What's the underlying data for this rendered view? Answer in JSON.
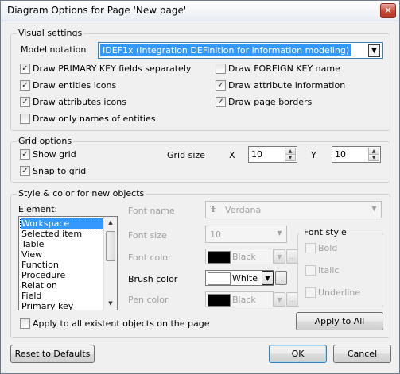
{
  "window": {
    "title": "Diagram Options for Page 'New page'",
    "close_glyph": "✕"
  },
  "visual_settings": {
    "title": "Visual settings",
    "model_notation_label": "Model notation",
    "model_notation_value": "IDEF1x (Integration DEFinition for information modeling)",
    "options": [
      {
        "label": "Draw PRIMARY KEY fields separately",
        "checked": true
      },
      {
        "label": "Draw entities icons",
        "checked": true
      },
      {
        "label": "Draw attributes icons",
        "checked": true
      },
      {
        "label": "Draw only names of entities",
        "checked": false
      },
      {
        "label": "Draw FOREIGN KEY name",
        "checked": false
      },
      {
        "label": "Draw attribute information",
        "checked": true
      },
      {
        "label": "Draw page borders",
        "checked": true
      }
    ]
  },
  "grid_options": {
    "title": "Grid options",
    "show_grid": {
      "label": "Show grid",
      "checked": true
    },
    "snap_to_grid": {
      "label": "Snap to grid",
      "checked": true
    },
    "grid_size_label": "Grid size",
    "x_label": "X",
    "x_value": "10",
    "y_label": "Y",
    "y_value": "10"
  },
  "style": {
    "title": "Style & color for new objects",
    "element_label": "Element:",
    "elements": [
      "Workspace",
      "Selected item",
      "Table",
      "View",
      "Function",
      "Procedure",
      "Relation",
      "Field",
      "Primary key"
    ],
    "selected_index": 0,
    "font_name_label": "Font name",
    "font_name_value": "Verdana",
    "font_size_label": "Font size",
    "font_size_value": "10",
    "font_color_label": "Font color",
    "font_color_value": "Black",
    "brush_color_label": "Brush color",
    "brush_color_value": "White",
    "pen_color_label": "Pen color",
    "pen_color_value": "Black",
    "font_style_title": "Font style",
    "bold_label": "Bold",
    "italic_label": "Italic",
    "underline_label": "Underline",
    "apply_all_objects_label": "Apply to all existent objects on the page",
    "apply_all_button": "Apply to All",
    "ellipsis": "..."
  },
  "footer": {
    "reset_button": "Reset to Defaults",
    "ok_button": "OK",
    "cancel_button": "Cancel"
  },
  "colors": {
    "selection": "#3399ff",
    "disabled_text": "#a0a0a0",
    "combo_selection": "#3399ff"
  }
}
